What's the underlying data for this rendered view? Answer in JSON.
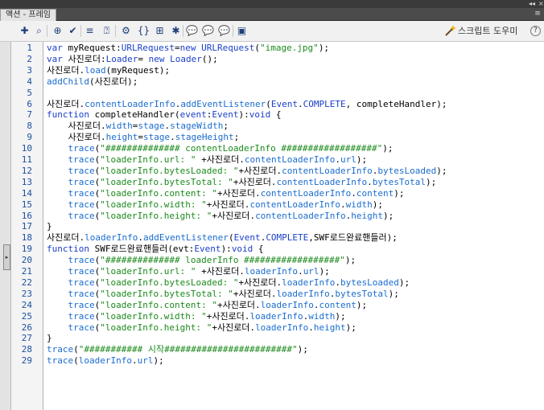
{
  "window": {
    "controls": {
      "collapse": "◂◂",
      "close": "×"
    }
  },
  "tab": {
    "label": "액션 - 프레임",
    "menu_icon": "panel-menu-icon"
  },
  "toolbar": {
    "buttons": [
      {
        "name": "add-statement-button",
        "icon": "plus-icon",
        "glyph": "✚"
      },
      {
        "name": "find-button",
        "icon": "magnifier-icon",
        "glyph": "⌕"
      },
      {
        "name": "target-path-button",
        "icon": "crosshair-icon",
        "glyph": "⊕"
      },
      {
        "name": "check-syntax-button",
        "icon": "checkmark-icon",
        "glyph": "✔"
      },
      {
        "name": "auto-format-button",
        "icon": "format-lines-icon",
        "glyph": "≡"
      },
      {
        "name": "code-hint-button",
        "icon": "code-hint-icon",
        "glyph": "⍰"
      },
      {
        "name": "debug-options-button",
        "icon": "debug-icon",
        "glyph": "⚙"
      },
      {
        "name": "collapse-braces-button",
        "icon": "collapse-braces-icon",
        "glyph": "{}"
      },
      {
        "name": "collapse-selection-button",
        "icon": "collapse-selection-icon",
        "glyph": "⊞"
      },
      {
        "name": "expand-all-button",
        "icon": "expand-all-icon",
        "glyph": "✱"
      },
      {
        "name": "block-comment-button",
        "icon": "block-comment-icon",
        "glyph": "💬"
      },
      {
        "name": "line-comment-button",
        "icon": "line-comment-icon",
        "glyph": "💬"
      },
      {
        "name": "remove-comment-button",
        "icon": "remove-comment-icon",
        "glyph": "💬"
      },
      {
        "name": "show-toolbox-button",
        "icon": "toolbox-icon",
        "glyph": "▣"
      }
    ],
    "script_helper_label": "스크립트 도우미",
    "script_helper_icon": "magic-wand-icon",
    "help_label": "?",
    "help_icon": "help-icon"
  },
  "sidebar": {
    "collapse_handle_glyph": "▸"
  },
  "editor": {
    "line_numbers": [
      "1",
      "2",
      "3",
      "4",
      "5",
      "6",
      "7",
      "8",
      "9",
      "10",
      "11",
      "12",
      "13",
      "14",
      "15",
      "16",
      "17",
      "18",
      "19",
      "20",
      "21",
      "22",
      "23",
      "24",
      "25",
      "26",
      "27",
      "28",
      "29"
    ],
    "lines": [
      [
        {
          "t": "kw",
          "v": "var"
        },
        {
          "t": "",
          "v": " myRequest:"
        },
        {
          "t": "kw",
          "v": "URLRequest"
        },
        {
          "t": "",
          "v": "="
        },
        {
          "t": "kw",
          "v": "new"
        },
        {
          "t": "",
          "v": " "
        },
        {
          "t": "kw",
          "v": "URLRequest"
        },
        {
          "t": "",
          "v": "("
        },
        {
          "t": "str",
          "v": "\"image.jpg\""
        },
        {
          "t": "",
          "v": ");"
        }
      ],
      [
        {
          "t": "kw",
          "v": "var"
        },
        {
          "t": "",
          "v": " 사진로더:"
        },
        {
          "t": "kw",
          "v": "Loader"
        },
        {
          "t": "",
          "v": "= "
        },
        {
          "t": "kw",
          "v": "new"
        },
        {
          "t": "",
          "v": " "
        },
        {
          "t": "kw",
          "v": "Loader"
        },
        {
          "t": "",
          "v": "();"
        }
      ],
      [
        {
          "t": "",
          "v": "사진로더."
        },
        {
          "t": "prop",
          "v": "load"
        },
        {
          "t": "",
          "v": "(myRequest);"
        }
      ],
      [
        {
          "t": "prop",
          "v": "addChild"
        },
        {
          "t": "",
          "v": "(사진로더);"
        }
      ],
      [],
      [
        {
          "t": "",
          "v": "사진로더."
        },
        {
          "t": "prop",
          "v": "contentLoaderInfo"
        },
        {
          "t": "",
          "v": "."
        },
        {
          "t": "prop",
          "v": "addEventListener"
        },
        {
          "t": "",
          "v": "("
        },
        {
          "t": "kw",
          "v": "Event"
        },
        {
          "t": "",
          "v": "."
        },
        {
          "t": "kw",
          "v": "COMPLETE"
        },
        {
          "t": "",
          "v": ", completeHandler);"
        }
      ],
      [
        {
          "t": "kw",
          "v": "function"
        },
        {
          "t": "",
          "v": " completeHandler("
        },
        {
          "t": "kw",
          "v": "event"
        },
        {
          "t": "",
          "v": ":"
        },
        {
          "t": "kw",
          "v": "Event"
        },
        {
          "t": "",
          "v": "):"
        },
        {
          "t": "kw",
          "v": "void"
        },
        {
          "t": "",
          "v": " {"
        }
      ],
      [
        {
          "t": "",
          "v": "    사진로더."
        },
        {
          "t": "prop",
          "v": "width"
        },
        {
          "t": "",
          "v": "="
        },
        {
          "t": "prop",
          "v": "stage"
        },
        {
          "t": "",
          "v": "."
        },
        {
          "t": "prop",
          "v": "stageWidth"
        },
        {
          "t": "",
          "v": ";"
        }
      ],
      [
        {
          "t": "",
          "v": "    사진로더."
        },
        {
          "t": "prop",
          "v": "height"
        },
        {
          "t": "",
          "v": "="
        },
        {
          "t": "prop",
          "v": "stage"
        },
        {
          "t": "",
          "v": "."
        },
        {
          "t": "prop",
          "v": "stageHeight"
        },
        {
          "t": "",
          "v": ";"
        }
      ],
      [
        {
          "t": "",
          "v": "    "
        },
        {
          "t": "prop",
          "v": "trace"
        },
        {
          "t": "",
          "v": "("
        },
        {
          "t": "str",
          "v": "\"############## contentLoaderInfo ##################\""
        },
        {
          "t": "",
          "v": ");"
        }
      ],
      [
        {
          "t": "",
          "v": "    "
        },
        {
          "t": "prop",
          "v": "trace"
        },
        {
          "t": "",
          "v": "("
        },
        {
          "t": "str",
          "v": "\"loaderInfo.url: \""
        },
        {
          "t": "",
          "v": " +사진로더."
        },
        {
          "t": "prop",
          "v": "contentLoaderInfo"
        },
        {
          "t": "",
          "v": "."
        },
        {
          "t": "prop",
          "v": "url"
        },
        {
          "t": "",
          "v": ");"
        }
      ],
      [
        {
          "t": "",
          "v": "    "
        },
        {
          "t": "prop",
          "v": "trace"
        },
        {
          "t": "",
          "v": "("
        },
        {
          "t": "str",
          "v": "\"loaderInfo.bytesLoaded: \""
        },
        {
          "t": "",
          "v": "+사진로더."
        },
        {
          "t": "prop",
          "v": "contentLoaderInfo"
        },
        {
          "t": "",
          "v": "."
        },
        {
          "t": "prop",
          "v": "bytesLoaded"
        },
        {
          "t": "",
          "v": ");"
        }
      ],
      [
        {
          "t": "",
          "v": "    "
        },
        {
          "t": "prop",
          "v": "trace"
        },
        {
          "t": "",
          "v": "("
        },
        {
          "t": "str",
          "v": "\"loaderInfo.bytesTotal: \""
        },
        {
          "t": "",
          "v": "+사진로더."
        },
        {
          "t": "prop",
          "v": "contentLoaderInfo"
        },
        {
          "t": "",
          "v": "."
        },
        {
          "t": "prop",
          "v": "bytesTotal"
        },
        {
          "t": "",
          "v": ");"
        }
      ],
      [
        {
          "t": "",
          "v": "    "
        },
        {
          "t": "prop",
          "v": "trace"
        },
        {
          "t": "",
          "v": "("
        },
        {
          "t": "str",
          "v": "\"loaderInfo.content: \""
        },
        {
          "t": "",
          "v": "+사진로더."
        },
        {
          "t": "prop",
          "v": "contentLoaderInfo"
        },
        {
          "t": "",
          "v": "."
        },
        {
          "t": "prop",
          "v": "content"
        },
        {
          "t": "",
          "v": ");"
        }
      ],
      [
        {
          "t": "",
          "v": "    "
        },
        {
          "t": "prop",
          "v": "trace"
        },
        {
          "t": "",
          "v": "("
        },
        {
          "t": "str",
          "v": "\"loaderInfo.width: \""
        },
        {
          "t": "",
          "v": "+사진로더."
        },
        {
          "t": "prop",
          "v": "contentLoaderInfo"
        },
        {
          "t": "",
          "v": "."
        },
        {
          "t": "prop",
          "v": "width"
        },
        {
          "t": "",
          "v": ");"
        }
      ],
      [
        {
          "t": "",
          "v": "    "
        },
        {
          "t": "prop",
          "v": "trace"
        },
        {
          "t": "",
          "v": "("
        },
        {
          "t": "str",
          "v": "\"loaderInfo.height: \""
        },
        {
          "t": "",
          "v": "+사진로더."
        },
        {
          "t": "prop",
          "v": "contentLoaderInfo"
        },
        {
          "t": "",
          "v": "."
        },
        {
          "t": "prop",
          "v": "height"
        },
        {
          "t": "",
          "v": ");"
        }
      ],
      [
        {
          "t": "",
          "v": "}"
        }
      ],
      [
        {
          "t": "",
          "v": "사진로더."
        },
        {
          "t": "prop",
          "v": "loaderInfo"
        },
        {
          "t": "",
          "v": "."
        },
        {
          "t": "prop",
          "v": "addEventListener"
        },
        {
          "t": "",
          "v": "("
        },
        {
          "t": "kw",
          "v": "Event"
        },
        {
          "t": "",
          "v": "."
        },
        {
          "t": "kw",
          "v": "COMPLETE"
        },
        {
          "t": "",
          "v": ",SWF로드완료핸들러);"
        }
      ],
      [
        {
          "t": "kw",
          "v": "function"
        },
        {
          "t": "",
          "v": " SWF로드완료핸들러(evt:"
        },
        {
          "t": "kw",
          "v": "Event"
        },
        {
          "t": "",
          "v": "):"
        },
        {
          "t": "kw",
          "v": "void"
        },
        {
          "t": "",
          "v": " {"
        }
      ],
      [
        {
          "t": "",
          "v": "    "
        },
        {
          "t": "prop",
          "v": "trace"
        },
        {
          "t": "",
          "v": "("
        },
        {
          "t": "str",
          "v": "\"############## loaderInfo ##################\""
        },
        {
          "t": "",
          "v": ");"
        }
      ],
      [
        {
          "t": "",
          "v": "    "
        },
        {
          "t": "prop",
          "v": "trace"
        },
        {
          "t": "",
          "v": "("
        },
        {
          "t": "str",
          "v": "\"loaderInfo.url: \""
        },
        {
          "t": "",
          "v": " +사진로더."
        },
        {
          "t": "prop",
          "v": "loaderInfo"
        },
        {
          "t": "",
          "v": "."
        },
        {
          "t": "prop",
          "v": "url"
        },
        {
          "t": "",
          "v": ");"
        }
      ],
      [
        {
          "t": "",
          "v": "    "
        },
        {
          "t": "prop",
          "v": "trace"
        },
        {
          "t": "",
          "v": "("
        },
        {
          "t": "str",
          "v": "\"loaderInfo.bytesLoaded: \""
        },
        {
          "t": "",
          "v": "+사진로더."
        },
        {
          "t": "prop",
          "v": "loaderInfo"
        },
        {
          "t": "",
          "v": "."
        },
        {
          "t": "prop",
          "v": "bytesLoaded"
        },
        {
          "t": "",
          "v": ");"
        }
      ],
      [
        {
          "t": "",
          "v": "    "
        },
        {
          "t": "prop",
          "v": "trace"
        },
        {
          "t": "",
          "v": "("
        },
        {
          "t": "str",
          "v": "\"loaderInfo.bytesTotal: \""
        },
        {
          "t": "",
          "v": "+사진로더."
        },
        {
          "t": "prop",
          "v": "loaderInfo"
        },
        {
          "t": "",
          "v": "."
        },
        {
          "t": "prop",
          "v": "bytesTotal"
        },
        {
          "t": "",
          "v": ");"
        }
      ],
      [
        {
          "t": "",
          "v": "    "
        },
        {
          "t": "prop",
          "v": "trace"
        },
        {
          "t": "",
          "v": "("
        },
        {
          "t": "str",
          "v": "\"loaderInfo.content: \""
        },
        {
          "t": "",
          "v": "+사진로더."
        },
        {
          "t": "prop",
          "v": "loaderInfo"
        },
        {
          "t": "",
          "v": "."
        },
        {
          "t": "prop",
          "v": "content"
        },
        {
          "t": "",
          "v": ");"
        }
      ],
      [
        {
          "t": "",
          "v": "    "
        },
        {
          "t": "prop",
          "v": "trace"
        },
        {
          "t": "",
          "v": "("
        },
        {
          "t": "str",
          "v": "\"loaderInfo.width: \""
        },
        {
          "t": "",
          "v": "+사진로더."
        },
        {
          "t": "prop",
          "v": "loaderInfo"
        },
        {
          "t": "",
          "v": "."
        },
        {
          "t": "prop",
          "v": "width"
        },
        {
          "t": "",
          "v": ");"
        }
      ],
      [
        {
          "t": "",
          "v": "    "
        },
        {
          "t": "prop",
          "v": "trace"
        },
        {
          "t": "",
          "v": "("
        },
        {
          "t": "str",
          "v": "\"loaderInfo.height: \""
        },
        {
          "t": "",
          "v": "+사진로더."
        },
        {
          "t": "prop",
          "v": "loaderInfo"
        },
        {
          "t": "",
          "v": "."
        },
        {
          "t": "prop",
          "v": "height"
        },
        {
          "t": "",
          "v": ");"
        }
      ],
      [
        {
          "t": "",
          "v": "}"
        }
      ],
      [
        {
          "t": "prop",
          "v": "trace"
        },
        {
          "t": "",
          "v": "("
        },
        {
          "t": "str",
          "v": "\"########### 시작########################\""
        },
        {
          "t": "",
          "v": ");"
        }
      ],
      [
        {
          "t": "prop",
          "v": "trace"
        },
        {
          "t": "",
          "v": "("
        },
        {
          "t": "prop",
          "v": "loaderInfo"
        },
        {
          "t": "",
          "v": "."
        },
        {
          "t": "prop",
          "v": "url"
        },
        {
          "t": "",
          "v": ");"
        }
      ]
    ]
  }
}
